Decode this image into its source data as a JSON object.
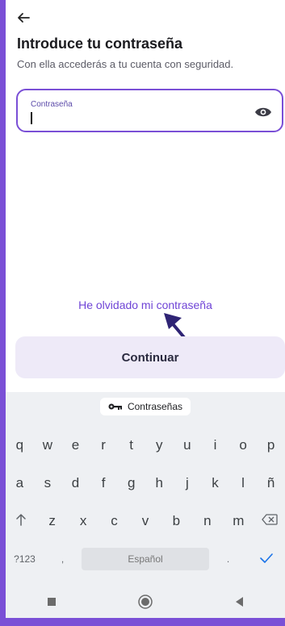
{
  "header": {
    "title": "Introduce tu contraseña",
    "subtitle": "Con ella accederás a tu cuenta con seguridad."
  },
  "password_field": {
    "label": "Contraseña"
  },
  "links": {
    "forgot": "He olvidado mi contraseña"
  },
  "actions": {
    "continue_label": "Continuar"
  },
  "keyboard": {
    "suggestion": "Contraseñas",
    "row1": [
      "q",
      "w",
      "e",
      "r",
      "t",
      "y",
      "u",
      "i",
      "o",
      "p"
    ],
    "row2": [
      "a",
      "s",
      "d",
      "f",
      "g",
      "h",
      "j",
      "k",
      "l",
      "ñ"
    ],
    "row3": [
      "z",
      "x",
      "c",
      "v",
      "b",
      "n",
      "m"
    ],
    "symbols_key": "?123",
    "comma_key": ",",
    "space_label": "Español",
    "period_key": ".",
    "shift_icon": "shift-up-arrow",
    "backspace_icon": "backspace",
    "enter_icon": "checkmark"
  },
  "colors": {
    "accent": "#7a4fd6",
    "link": "#6f44d6",
    "button_bg": "#eeeaf8"
  }
}
